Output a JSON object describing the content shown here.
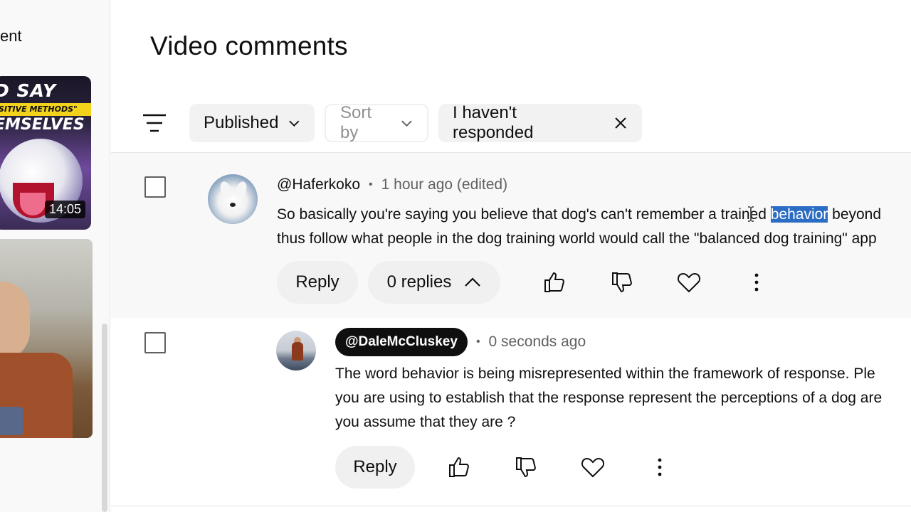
{
  "side_panel": {
    "label_fragment": "ent",
    "thumbnail": {
      "line1": "D SAY",
      "line2": "SITIVE METHODS\"",
      "line3": "EMSELVES",
      "duration": "14:05"
    }
  },
  "page": {
    "title": "Video comments"
  },
  "filters": {
    "published_label": "Published",
    "sort_label": "Sort by",
    "responded_label": "I haven't responded"
  },
  "comments": [
    {
      "author": "@Haferkoko",
      "separator": "•",
      "time": "1 hour ago (edited)",
      "text_line1_before": "So basically you're saying you believe that dog's can't remember a trained ",
      "text_line1_highlight": "behavior",
      "text_line1_after": " beyond",
      "text_line2": "thus follow what people in the dog training world would call the \"balanced dog training\" app",
      "reply_label": "Reply",
      "replies_label": "0 replies"
    },
    {
      "author": "@DaleMcCluskey",
      "separator": "•",
      "time": "0 seconds ago",
      "text_line1": "The word behavior is being misrepresented within the framework of response.  Ple",
      "text_line2": "you are using to establish that the response represent the perceptions of a dog are",
      "text_line3": "you assume that they are ?",
      "reply_label": "Reply"
    }
  ],
  "icons": {
    "filter": "filter-lines-icon",
    "chevron": "chevron-down-icon",
    "close": "close-icon",
    "like": "thumbs-up-icon",
    "dislike": "thumbs-down-icon",
    "heart": "heart-icon",
    "more": "more-vertical-icon"
  }
}
